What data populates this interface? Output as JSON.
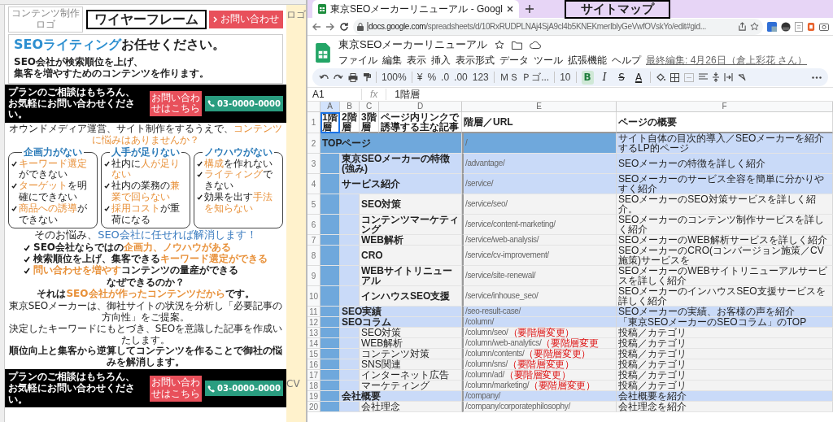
{
  "wireframe": {
    "label": "ワイヤーフレーム",
    "logo": [
      "コンテンツ制作",
      "ロゴ"
    ],
    "contact_button": "お問い合わせ",
    "hero": {
      "title": [
        {
          "text": "SEOライティング",
          "accent": true
        },
        {
          "text": "お任せください。",
          "accent": false
        }
      ],
      "lead": [
        "SEO会社が検索順位を上げ、",
        "集客を増やすためのコンテンツを作ります。"
      ]
    },
    "cta_top": {
      "text": [
        "プランのご相談はもちろん、",
        "お気軽にお問い合わせください。"
      ],
      "button": "お問い合わせはこちら",
      "phone": "03-0000-0000"
    },
    "question": [
      {
        "text": "オウンドメディア運営、サイト制作をするうえで、",
        "accent": false
      },
      {
        "text": "コンテンツに悩みはありませんか？",
        "accent": true
      }
    ],
    "problems": [
      {
        "title": "企画力がない",
        "items": [
          [
            {
              "text": "キーワード選定",
              "accent": true
            },
            {
              "text": "ができない",
              "accent": false
            }
          ],
          [
            {
              "text": "ターゲット",
              "accent": true
            },
            {
              "text": "を明確にできない",
              "accent": false
            }
          ],
          [
            {
              "text": "商品への誘導",
              "accent": true
            },
            {
              "text": "ができない",
              "accent": false
            }
          ]
        ]
      },
      {
        "title": "人手が足りない",
        "items": [
          [
            {
              "text": "社内に",
              "accent": false
            },
            {
              "text": "人が足りない",
              "accent": true
            }
          ],
          [
            {
              "text": "社内の業務の",
              "accent": false
            },
            {
              "text": "兼業で回らない",
              "accent": true
            }
          ],
          [
            {
              "text": "採用コスト",
              "accent": true
            },
            {
              "text": "が重荷になる",
              "accent": false
            }
          ]
        ]
      },
      {
        "title": "ノウハウがない",
        "items": [
          [
            {
              "text": "構成",
              "accent": true
            },
            {
              "text": "を作れない",
              "accent": false
            }
          ],
          [
            {
              "text": "ライティング",
              "accent": true
            },
            {
              "text": "できない",
              "accent": false
            }
          ],
          [
            {
              "text": "効果を出す",
              "accent": false
            },
            {
              "text": "手法を知らない",
              "accent": true
            }
          ]
        ]
      }
    ],
    "solution": {
      "title": [
        {
          "text": "そのお悩み、",
          "accent": false
        },
        {
          "text": "SEO会社に任せれば解消します！",
          "accent": true
        }
      ],
      "checks": [
        [
          {
            "text": "SEO会社ならではの",
            "accent": false
          },
          {
            "text": "企画力、ノウハウがある",
            "accent": true
          }
        ],
        [
          {
            "text": "検索順位を上げ、集客できる",
            "accent": false
          },
          {
            "text": "キーワード選定ができる",
            "accent": true
          }
        ],
        [
          {
            "text": "問い合わせを増やす",
            "accent": true
          },
          {
            "text": "コンテンツの量産ができる",
            "accent": false
          }
        ]
      ]
    },
    "why": "なぜできるのか？",
    "answer": [
      {
        "text": "それは",
        "accent": false
      },
      {
        "text": "SEO会社が作ったコンテンツだから",
        "accent": true
      },
      {
        "text": "です。",
        "accent": false
      }
    ],
    "description": [
      {
        "text": "東京SEOメーカーは、御社サイトの状況を分析し「必要記事の方向性」をご提案。",
        "bold": false
      },
      {
        "text": "決定したキーワードにもとづき、SEOを意識した記事を作成いたします。",
        "bold": false
      },
      {
        "text": "順位向上と集客から逆算してコンテンツを作ることで御社の悩みを解消します。",
        "bold": true
      }
    ],
    "cta_bottom": {
      "text": [
        "プランのご相談はもちろん、",
        "お気軽にお問い合わせください。"
      ],
      "button": "お問い合わせはこちら",
      "phone": "03-0000-0000"
    },
    "notes": [
      "ロゴ",
      "CV"
    ]
  },
  "browser": {
    "tab": {
      "title": "東京SEOメーカーリニューアル - Googl"
    },
    "url_host": "docs.google.com",
    "url_path": "/spreadsheets/d/10RxRUDPLNAj4SjA9cl4b5KNEKmerIblyGeVwfOVskYo/edit#gid..."
  },
  "sitemap_label": "サイトマップ",
  "sheet": {
    "title": "東京SEOメーカーリニューアル",
    "menus": [
      "ファイル",
      "編集",
      "表示",
      "挿入",
      "表示形式",
      "データ",
      "ツール",
      "拡張機能",
      "ヘルプ"
    ],
    "last_edit": "最終編集: 4月26日（倉上彩花 さん）",
    "toolbar": {
      "zoom": "100%",
      "currency": "¥",
      "percent": "%",
      "decimal_less": ".0",
      "decimal_more": ".00",
      "number_format": "123",
      "font": "ＭＳ Ｐゴ...",
      "font_size": "10",
      "format_buttons": [
        {
          "kind": "bold",
          "label": "B",
          "on": true
        },
        {
          "kind": "italic",
          "label": "I",
          "on": false
        },
        {
          "kind": "strike",
          "label": "S",
          "on": false
        },
        {
          "kind": "color",
          "label": "A",
          "on": false
        }
      ]
    },
    "name_box": "A1",
    "fx_label": "fx",
    "formula": "1階層",
    "columns": [
      {
        "letter": "A",
        "selected": true
      },
      {
        "letter": "B",
        "selected": false
      },
      {
        "letter": "C",
        "selected": false
      },
      {
        "letter": "D",
        "selected": false
      },
      {
        "letter": "E",
        "selected": false
      },
      {
        "letter": "F",
        "selected": false
      }
    ],
    "header_row": {
      "row": "1",
      "cells": [
        {
          "text": "1階層",
          "selected": true
        },
        {
          "text": "2階層",
          "selected": false
        },
        {
          "text": "3階層",
          "selected": false
        },
        {
          "text": "ページ内リンクで誘導する主な記事",
          "selected": false
        },
        {
          "text": "階層／URL",
          "selected": false
        },
        {
          "text": "ページの概要",
          "selected": false
        }
      ]
    },
    "rows": [
      {
        "row": "2",
        "name": "TOPページ",
        "bold": true,
        "url": "/",
        "summary": "サイト自体の目次的導入／SEOメーカーを紹介するLP的ページ",
        "children": [
          {
            "row": "3",
            "name": "東京SEOメーカーの特徴(強み)",
            "bold": true,
            "url": "/advantage/",
            "summary": "SEOメーカーの特徴を詳しく紹介"
          },
          {
            "row": "4",
            "name": "サービス紹介",
            "bold": true,
            "url": "/service/",
            "summary": "SEOメーカーのサービス全容を簡単に分かりやすく紹介",
            "children": [
              {
                "row": "5",
                "name": "SEO対策",
                "bold": true,
                "url": "/service/seo/",
                "summary": "SEOメーカーのSEO対策サービスを詳しく紹介。"
              },
              {
                "row": "6",
                "name": "コンテンツマーケティング",
                "bold": true,
                "url": "/service/content-marketing/",
                "summary": "SEOメーカーのコンテンツ制作サービスを詳しく紹介"
              },
              {
                "row": "7",
                "name": "WEB解析",
                "bold": true,
                "url": "/service/web-analysis/",
                "summary": "SEOメーカーのWEB解析サービスを詳しく紹介"
              },
              {
                "row": "8",
                "name": "CRO",
                "bold": true,
                "url": "/service/cv-improvement/",
                "summary": "SEOメーカーのCRO(コンバージョン施策／CV施策)サービスを"
              },
              {
                "row": "9",
                "name": "WEBサイトリニューアル",
                "bold": true,
                "url": "/service/site-renewal/",
                "summary": "SEOメーカーのWEBサイトリニューアルサービスを詳しく紹介"
              },
              {
                "row": "10",
                "name": "インハウスSEO支援",
                "bold": true,
                "url": "/service/inhouse_seo/",
                "summary": "SEOメーカーのインハウスSEO支援サービスを詳しく紹介"
              }
            ]
          },
          {
            "row": "11",
            "name": "SEO実績",
            "bold": true,
            "url": "/seo-result-case/",
            "summary": "SEOメーカーの実績、お客様の声を紹介"
          },
          {
            "row": "12",
            "name": "SEOコラム",
            "bold": true,
            "url": "/column/",
            "summary": "「東京SEOメーカーのSEOコラム」のTOP",
            "children": [
              {
                "row": "13",
                "name": "SEO対策",
                "bold": false,
                "url": "/column/seo/",
                "url_note": "（要階層変更）",
                "summary": "投稿／カテゴリ"
              },
              {
                "row": "14",
                "name": "WEB解析",
                "bold": false,
                "url": "/column/web-analytics/",
                "url_note": "（要階層変更",
                "summary": "投稿／カテゴリ"
              },
              {
                "row": "15",
                "name": "コンテンツ対策",
                "bold": false,
                "url": "/column/contents/",
                "url_note": "（要階層変更）",
                "summary": "投稿／カテゴリ"
              },
              {
                "row": "16",
                "name": "SNS関連",
                "bold": false,
                "url": "/column/sns/",
                "url_note": "（要階層変更）",
                "summary": "投稿／カテゴリ"
              },
              {
                "row": "17",
                "name": "インターネット広告",
                "bold": false,
                "url": "/column/ad/",
                "url_note": "（要階層変更）",
                "summary": "投稿／カテゴリ"
              },
              {
                "row": "18",
                "name": "マーケティング",
                "bold": false,
                "url": "/column/marketing/",
                "url_note": "（要階層変更）",
                "summary": "投稿／カテゴリ"
              }
            ]
          },
          {
            "row": "19",
            "name": "会社概要",
            "bold": true,
            "url": "/company/",
            "summary": "会社概要を紹介",
            "children": [
              {
                "row": "20",
                "name": "会社理念",
                "bold": false,
                "url": "/company/corporatephilosophy/",
                "summary": "会社理念を紹介"
              }
            ]
          }
        ]
      }
    ]
  }
}
